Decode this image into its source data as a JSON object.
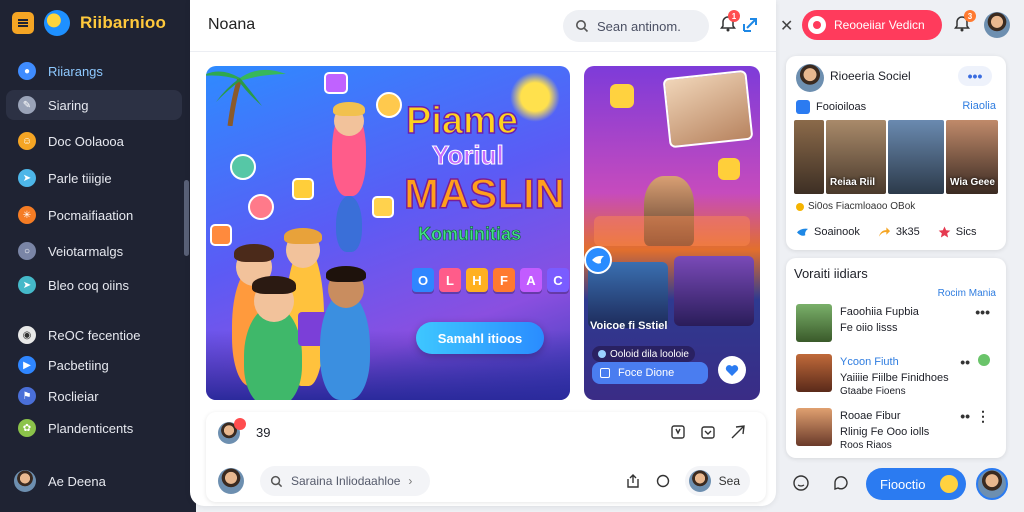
{
  "app": {
    "name": "Riibarnioo"
  },
  "sidebar": {
    "items": [
      {
        "label": "Riiarangs",
        "icon": "user-icon",
        "color": "#3f8cff"
      },
      {
        "label": "Siaring",
        "icon": "pencil-icon",
        "color": "#9aa3b8"
      },
      {
        "label": "Doc Oolaooa",
        "icon": "people-icon",
        "color": "#f5a524"
      },
      {
        "label": "Parle tiiigie",
        "icon": "chat-icon",
        "color": "#4db6e8"
      },
      {
        "label": "Pocmaifiaation",
        "icon": "spark-icon",
        "color": "#f57c24"
      },
      {
        "label": "Veiotarmalgs",
        "icon": "globe-icon",
        "color": "#7a85a6"
      },
      {
        "label": "Bleo coq oiins",
        "icon": "send-icon",
        "color": "#45b9c9"
      },
      {
        "label": "ReOC fecentioe",
        "icon": "group-icon",
        "color": "#e8e8e8"
      },
      {
        "label": "Pacbetiing",
        "icon": "play-icon",
        "color": "#2f86ff"
      },
      {
        "label": "Roclieiar",
        "icon": "flag-icon",
        "color": "#4a6fd8"
      },
      {
        "label": "Plandenticents",
        "icon": "leaf-icon",
        "color": "#8bc34a"
      }
    ],
    "user": {
      "label": "Ae Deena"
    }
  },
  "main": {
    "title": "Noana",
    "search_placeholder": "Sean antinom.",
    "notif_badge": "1",
    "hero": {
      "line1": "Piame",
      "line2": "Yoriul",
      "line3": "MASLIN",
      "line4": "Komuinitias",
      "tiles": [
        "O",
        "L",
        "H",
        "F",
        "A",
        "C"
      ],
      "cta": "Samahl itioos"
    },
    "side": {
      "caption": "Voicoe fi Sstiel",
      "tag": "Ooloid dila looloie",
      "button": "Foce Dione"
    },
    "composer": {
      "count": "39",
      "input_placeholder": "Saraina Inliodaahloe",
      "send_label": "Sea"
    }
  },
  "right": {
    "live_button": "Reooeiiar Vedicn",
    "bell_badge": "3",
    "profile": {
      "name": "Rioeeria Sociel",
      "subtitle": "Fooioiloas",
      "link": "Riaolia",
      "photo_labels": [
        "Reiaa Riil",
        "Wia Geee"
      ],
      "meta": "Si0os Fiacmloaoo OBok",
      "actions": [
        {
          "label": "Soainook",
          "icon": "bird-icon"
        },
        {
          "label": "3k35",
          "icon": "share-arrow-icon"
        },
        {
          "label": "Sics",
          "icon": "star-icon"
        }
      ]
    },
    "suggestions": {
      "title": "Voraiti iidiars",
      "link": "Rocim Mania",
      "items": [
        {
          "name": "Faoohiia Fupbia",
          "sub": "Fe oiio lisss",
          "sub2": ""
        },
        {
          "name": "Ycoon Fiuth",
          "sub": "Yaiiiie Fiilbe Finidhoes",
          "sub2": "Gtaabe Fioens"
        },
        {
          "name": "Rooae Fibur",
          "sub": "Rlinig Fe Ooo iolls",
          "sub2": "Roos Riaos"
        }
      ]
    },
    "bottom_button": "Fiooctio"
  }
}
